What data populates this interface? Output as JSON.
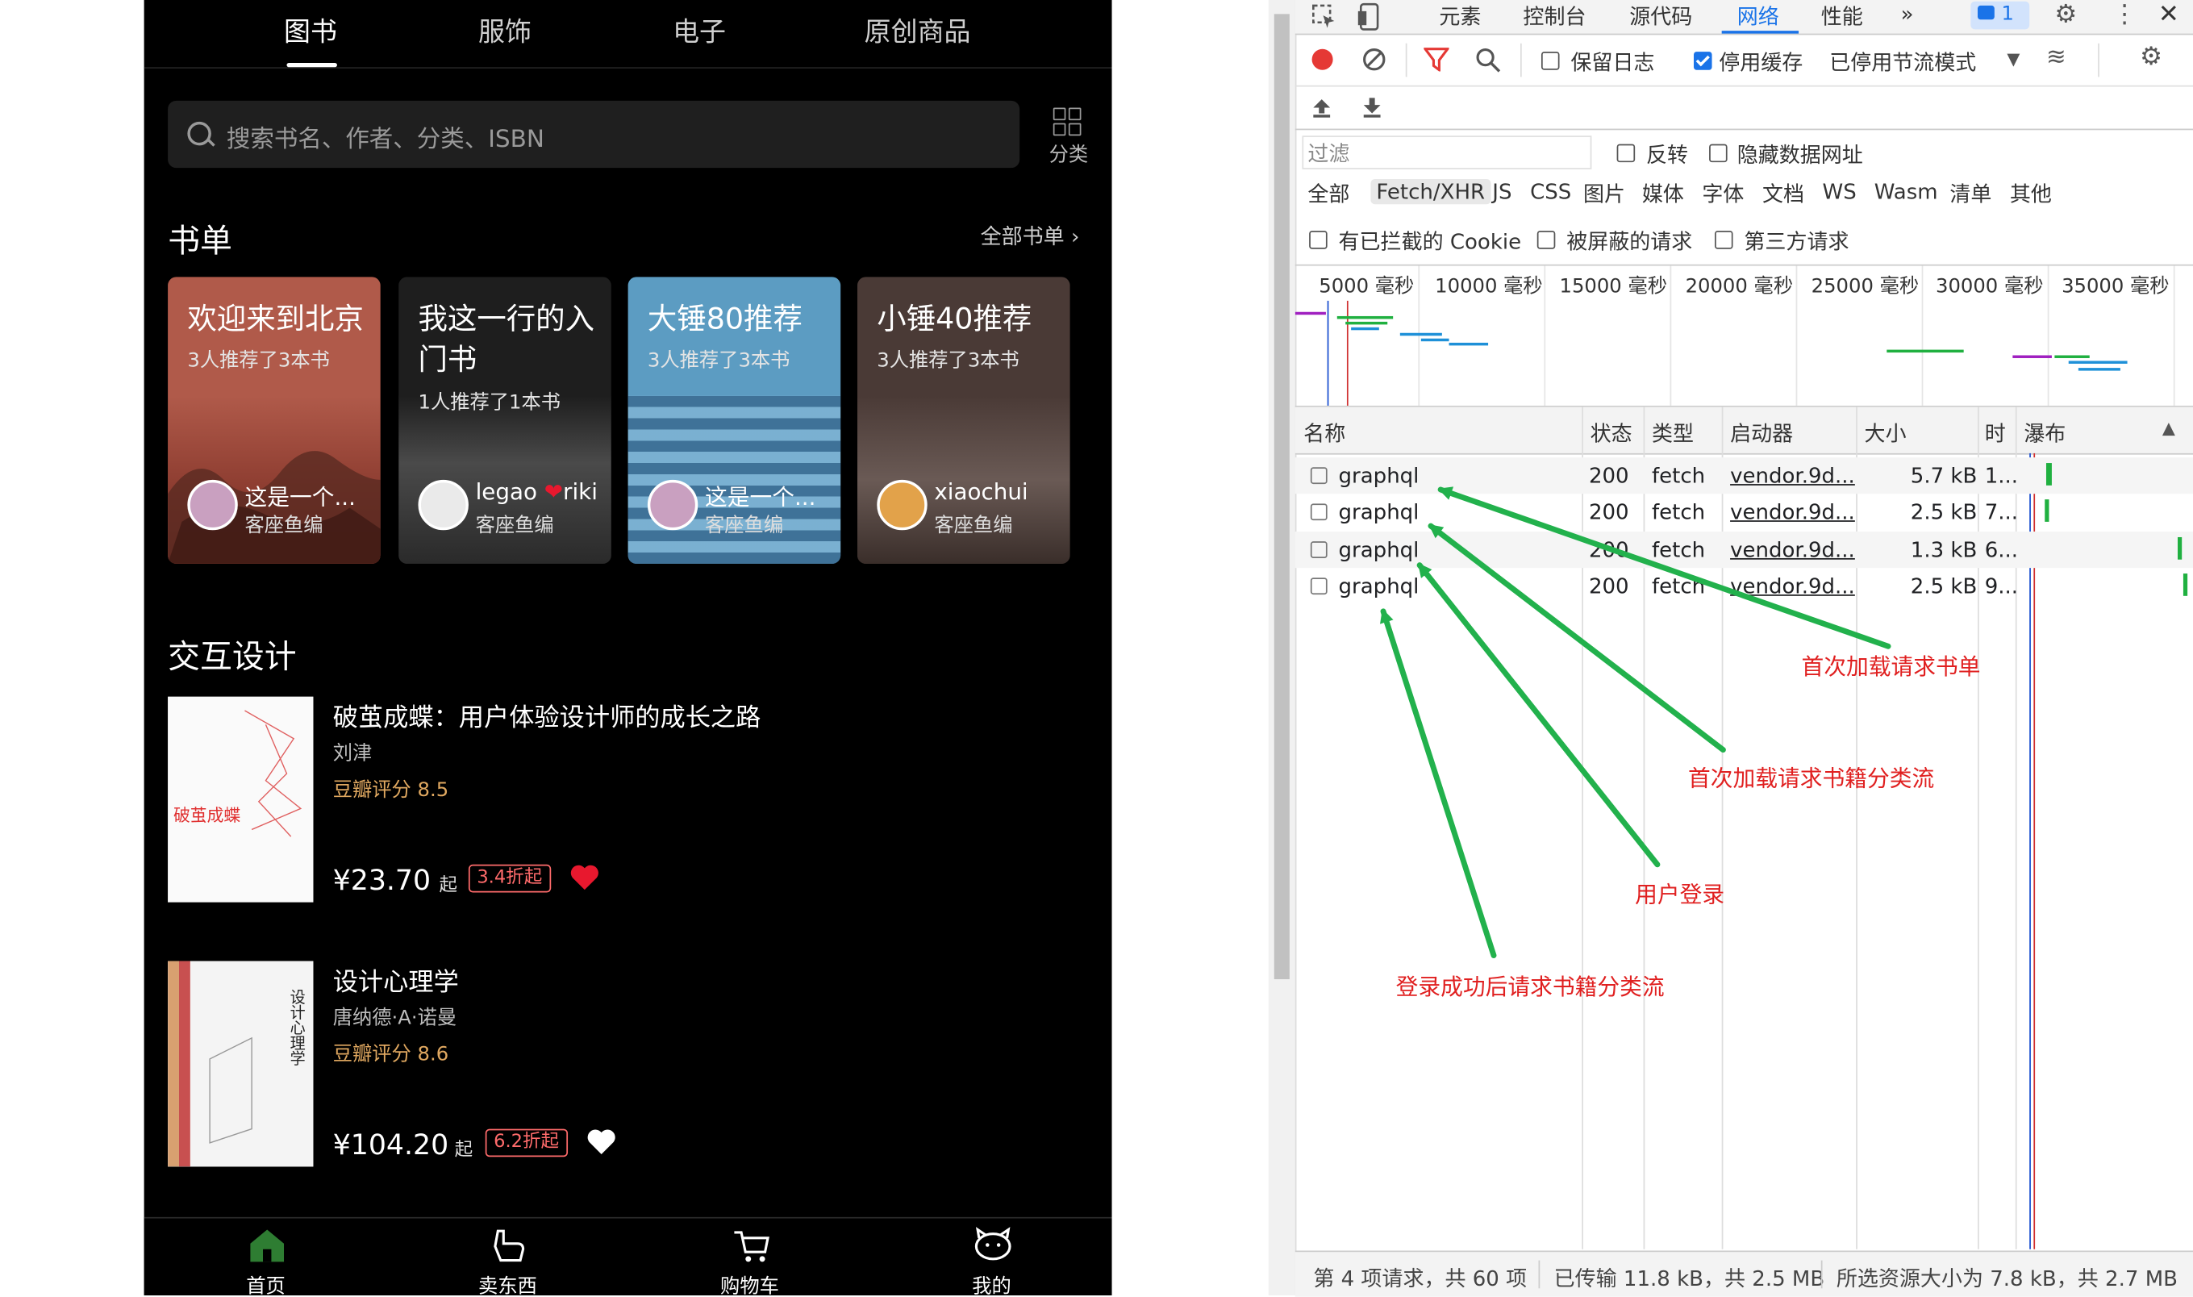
{
  "app": {
    "tabs": [
      "图书",
      "服饰",
      "电子",
      "原创商品"
    ],
    "search_placeholder": "搜索书名、作者、分类、ISBN",
    "category_label": "分类",
    "booklist": {
      "title": "书单",
      "all_link": "全部书单",
      "cards": [
        {
          "title": "欢迎来到北京",
          "subtitle": "3人推荐了3本书",
          "user": "这是一个...",
          "role": "客座鱼编"
        },
        {
          "title": "我这一行的入门书",
          "subtitle": "1人推荐了1本书",
          "user": "legao",
          "user2": "riki",
          "role": "客座鱼编"
        },
        {
          "title": "大锤80推荐",
          "subtitle": "3人推荐了3本书",
          "user": "这是一个...",
          "role": "客座鱼编"
        },
        {
          "title": "小锤40推荐",
          "subtitle": "3人推荐了3本书",
          "user": "xiaochui",
          "role": "客座鱼编"
        }
      ]
    },
    "design_section": {
      "title": "交互设计",
      "books": [
        {
          "name": "破茧成蝶：用户体验设计师的成长之路",
          "author": "刘津",
          "rating": "豆瓣评分 8.5",
          "price": "¥23.70",
          "qi": "起",
          "discount": "3.4折起",
          "liked": true,
          "cover_title": "破茧成蝶"
        },
        {
          "name": "设计心理学",
          "author": "唐纳德·A·诺曼",
          "rating": "豆瓣评分 8.6",
          "price": "¥104.20",
          "qi": "起",
          "discount": "6.2折起",
          "liked": false,
          "cover_title": "设计心理学"
        }
      ]
    },
    "nav": [
      {
        "label": "首页",
        "icon": "home-icon",
        "active": true
      },
      {
        "label": "卖东西",
        "icon": "sell-hand-icon",
        "active": false
      },
      {
        "label": "购物车",
        "icon": "cart-icon",
        "active": false
      },
      {
        "label": "我的",
        "icon": "profile-icon",
        "active": false
      }
    ]
  },
  "devtools": {
    "tabs": [
      "元素",
      "控制台",
      "源代码",
      "网络",
      "性能"
    ],
    "active_tab": "网络",
    "more": "»",
    "issues_count": "1",
    "toolbar": {
      "preserve_log": "保留日志",
      "disable_cache": "停用缓存",
      "throttle": "已停用节流模式",
      "disable_cache_checked": true,
      "preserve_log_checked": false
    },
    "filter": {
      "placeholder": "过滤",
      "invert": "反转",
      "hide_data_urls": "隐藏数据网址"
    },
    "types": [
      "全部",
      "Fetch/XHR",
      "JS",
      "CSS",
      "图片",
      "媒体",
      "字体",
      "文档",
      "WS",
      "Wasm",
      "清单",
      "其他"
    ],
    "active_type": "Fetch/XHR",
    "cookie_filters": [
      "有已拦截的 Cookie",
      "被屏蔽的请求",
      "第三方请求"
    ],
    "timeline_ticks": [
      "5000 毫秒",
      "10000 毫秒",
      "15000 毫秒",
      "20000 毫秒",
      "25000 毫秒",
      "30000 毫秒",
      "35000 毫秒"
    ],
    "columns": [
      "名称",
      "状态",
      "类型",
      "启动器",
      "大小",
      "时",
      "瀑布"
    ],
    "rows": [
      {
        "name": "graphql",
        "status": "200",
        "type": "fetch",
        "initiator": "vendor.9d...",
        "size": "5.7 kB",
        "time": "1..."
      },
      {
        "name": "graphql",
        "status": "200",
        "type": "fetch",
        "initiator": "vendor.9d...",
        "size": "2.5 kB",
        "time": "7..."
      },
      {
        "name": "graphql",
        "status": "200",
        "type": "fetch",
        "initiator": "vendor.9d...",
        "size": "1.3 kB",
        "time": "6..."
      },
      {
        "name": "graphql",
        "status": "200",
        "type": "fetch",
        "initiator": "vendor.9d...",
        "size": "2.5 kB",
        "time": "9..."
      }
    ],
    "status_bar": [
      "第 4 项请求，共 60 项",
      "已传输 11.8 kB，共 2.5 MB",
      "所选资源大小为 7.8 kB，共 2.7 MB"
    ]
  },
  "annotations": [
    "首次加载请求书单",
    "首次加载请求书籍分类流",
    "用户登录",
    "登录成功后请求书籍分类流"
  ],
  "colors": {
    "annotation": "#e02020",
    "arrow": "#22b14c",
    "accent": "#1a73e8",
    "heart": "#e8182e",
    "rating": "#e0a860"
  }
}
